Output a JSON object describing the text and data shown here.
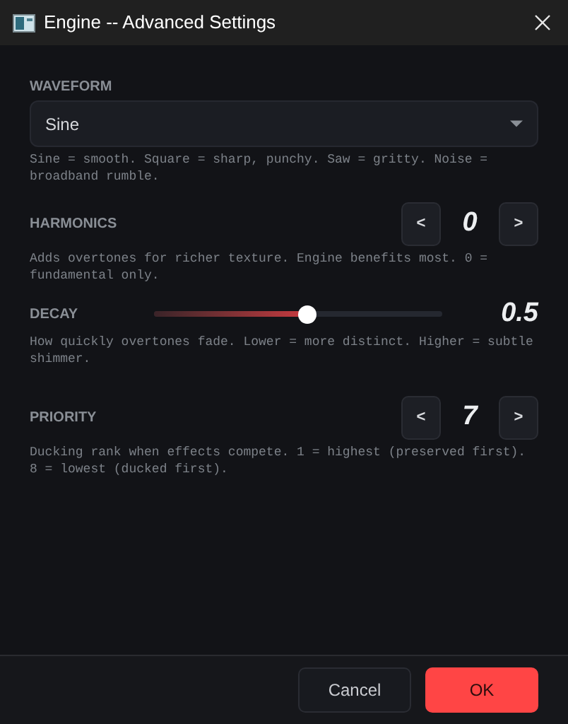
{
  "window": {
    "title": "Engine -- Advanced Settings"
  },
  "settings": [
    {
      "kind": "select",
      "label": "WAVEFORM",
      "value": "Sine",
      "help": "Sine = smooth. Square = sharp, punchy. Saw = gritty. Noise = broadband rumble."
    },
    {
      "kind": "stepper",
      "label": "HARMONICS",
      "value": "0",
      "help": "Adds overtones for richer texture. Engine benefits most. 0 = fundamental only.",
      "decrement": "<",
      "increment": ">"
    },
    {
      "kind": "slider",
      "label": "DECAY",
      "value": "0.5",
      "level": 0.53,
      "help": "How quickly overtones fade. Lower = more distinct. Higher = subtle shimmer."
    },
    {
      "kind": "stepper",
      "label": "PRIORITY",
      "value": "7",
      "help": "Ducking rank when effects compete. 1 = highest (preserved first). 8 = lowest (ducked first).",
      "decrement": "<",
      "increment": ">"
    }
  ],
  "buttons": [
    {
      "label": "Cancel",
      "kind": "secondary"
    },
    {
      "label": "OK",
      "kind": "primary"
    }
  ]
}
